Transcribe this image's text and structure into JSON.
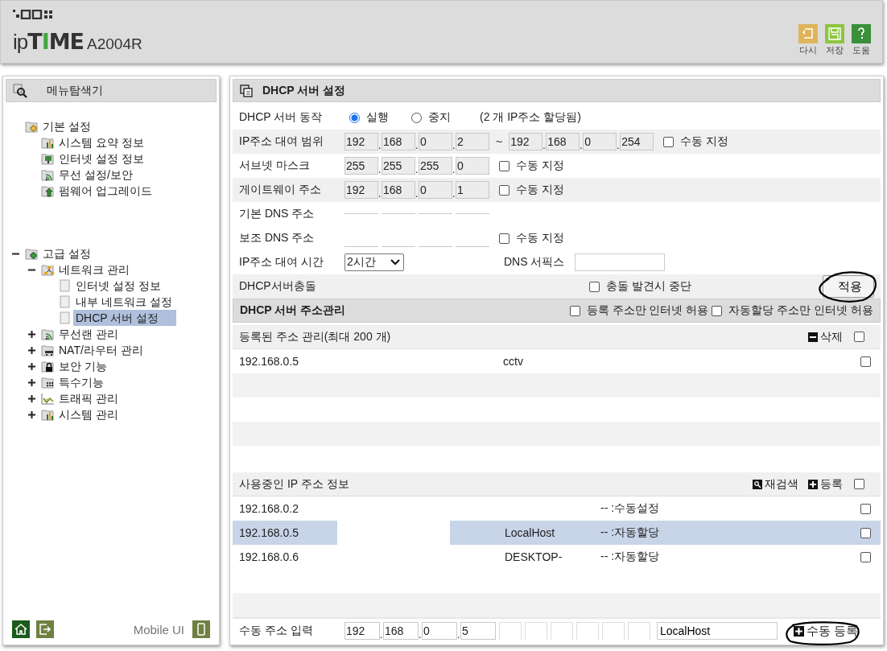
{
  "header": {
    "logo": {
      "prefix": "ip",
      "t": "T",
      "i": "I",
      "me": "ME"
    },
    "model": "A2004R",
    "tools": [
      {
        "label": "다시",
        "color": "#e0b45a",
        "kind": "undo"
      },
      {
        "label": "저장",
        "color": "#8cc63f",
        "kind": "save"
      },
      {
        "label": "도움",
        "color": "#3a8f3a",
        "kind": "help"
      }
    ]
  },
  "sidebar": {
    "title": "메뉴탐색기",
    "tree": [
      {
        "label": "기본 설정",
        "kind": "folder-orange",
        "children": [
          {
            "label": "시스템 요약 정보",
            "kind": "chart"
          },
          {
            "label": "인터넷 설정 정보",
            "kind": "monitor"
          },
          {
            "label": "무선 설정/보안",
            "kind": "wifi"
          },
          {
            "label": "펌웨어 업그레이드",
            "kind": "upload"
          }
        ]
      },
      {
        "label": "고급 설정",
        "kind": "folder-green",
        "expanded": true,
        "children": [
          {
            "label": "네트워크 관리",
            "kind": "network",
            "expanded": true,
            "children": [
              {
                "label": "인터넷 설정 정보",
                "kind": "page",
                "selected": false
              },
              {
                "label": "내부 네트워크 설정",
                "kind": "page",
                "selected": false
              },
              {
                "label": "DHCP 서버 설정",
                "kind": "page",
                "selected": true
              }
            ]
          },
          {
            "label": "무선랜 관리",
            "kind": "wifi",
            "expanded": false
          },
          {
            "label": "NAT/라우터 관리",
            "kind": "router",
            "expanded": false
          },
          {
            "label": "보안 기능",
            "kind": "lock",
            "expanded": false
          },
          {
            "label": "특수기능",
            "kind": "dots",
            "expanded": false
          },
          {
            "label": "트래픽 관리",
            "kind": "traffic",
            "expanded": false
          },
          {
            "label": "시스템 관리",
            "kind": "chart",
            "expanded": false
          }
        ]
      }
    ],
    "mobile": "Mobile UI"
  },
  "main": {
    "title": "DHCP 서버 설정",
    "octet_separator": ".",
    "server_mode": {
      "label": "DHCP 서버 동작",
      "options": [
        {
          "label": "실행",
          "selected": true
        },
        {
          "label": "중지",
          "selected": false
        }
      ],
      "note": "(2 개 IP주소 할당됨)"
    },
    "range": {
      "label": "IP주소 대여 범위",
      "start": [
        "192",
        "168",
        "0",
        "2"
      ],
      "separator": "~",
      "end": [
        "192",
        "168",
        "0",
        "254"
      ],
      "manual": {
        "label": "수동 지정",
        "checked": false
      }
    },
    "subnet": {
      "label": "서브넷 마스크",
      "octets": [
        "255",
        "255",
        "255",
        "0"
      ],
      "manual": {
        "label": "수동 지정",
        "checked": false
      }
    },
    "gateway": {
      "label": "게이트웨이 주소",
      "octets": [
        "192",
        "168",
        "0",
        "1"
      ],
      "manual": {
        "label": "수동 지정",
        "checked": false
      }
    },
    "dns1": {
      "label": "기본 DNS 주소"
    },
    "dns2": {
      "label": "보조 DNS 주소",
      "manual": {
        "label": "수동 지정",
        "checked": false
      }
    },
    "lease": {
      "label": "IP주소 대여 시간",
      "value": "2시간",
      "suffix_label": "DNS 서픽스"
    },
    "conflict": {
      "label": "DHCP서버충돌",
      "option": {
        "label": "충돌 발견시 중단",
        "checked": false
      },
      "apply": "적용"
    },
    "address_mgmt": {
      "title": "DHCP 서버 주소관리",
      "options": [
        {
          "label": "등록 주소만 인터넷 허용",
          "checked": false
        },
        {
          "label": "자동할당 주소만 인터넷 허용",
          "checked": false
        }
      ]
    },
    "registered": {
      "title": "등록된 주소 관리(최대 200 개)",
      "delete": "삭제",
      "all_checked": false,
      "rows": [
        {
          "ip": "192.168.0.5",
          "name": "cctv",
          "checked": false
        }
      ]
    },
    "in_use": {
      "title": "사용중인 IP 주소 정보",
      "rescan": "재검색",
      "register": "등록",
      "all_checked": false,
      "rows": [
        {
          "ip": "192.168.0.2",
          "type": "-- :수동설정",
          "selected": false,
          "checked": false
        },
        {
          "ip": "192.168.0.5",
          "name": "LocalHost",
          "type": "-- :자동할당",
          "selected": true,
          "checked": false
        },
        {
          "ip": "192.168.0.6",
          "name": "DESKTOP-",
          "type": "-- :자동할당",
          "selected": false,
          "checked": false
        }
      ]
    },
    "manual_entry": {
      "label": "수동 주소 입력",
      "octets": [
        "192",
        "168",
        "0",
        "5"
      ],
      "name": "LocalHost",
      "button": "수동 등록"
    }
  }
}
